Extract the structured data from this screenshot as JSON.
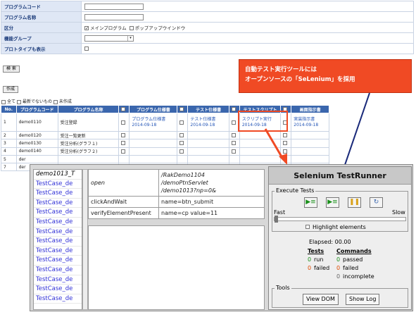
{
  "form": {
    "rows": [
      {
        "label": "プログラムコード",
        "type": "text"
      },
      {
        "label": "プログラム名称",
        "type": "text"
      },
      {
        "label": "区分",
        "type": "check",
        "options": [
          "メインプログラム",
          "ポップアップウインドウ"
        ]
      },
      {
        "label": "機能グループ",
        "type": "select"
      },
      {
        "label": "プロトタイプも表示",
        "type": "checkbox"
      }
    ],
    "search_button": "検 索",
    "create_button": "作成"
  },
  "filters": [
    "全て",
    "最新でないもの",
    "未作成"
  ],
  "grid": {
    "headers": [
      "No.",
      "プログラムコード",
      "プログラム名称",
      "",
      "プログラム仕様書",
      "",
      "テスト仕様書",
      "",
      "テストスクリプト",
      "",
      "画面指示書"
    ],
    "rows": [
      {
        "no": "1",
        "code": "demo0110",
        "name": "受注登録",
        "spec": [
          "プログラム仕様書",
          "2014-09-18"
        ],
        "test": [
          "テスト仕様書",
          "2014-09-18"
        ],
        "script": [
          "スクリプト実行",
          "2014-09-18"
        ],
        "screen": [
          "実装指示書",
          "2014-09-18"
        ]
      },
      {
        "no": "2",
        "code": "demo0120",
        "name": "受注一覧更新"
      },
      {
        "no": "3",
        "code": "demo0130",
        "name": "受注分析(グラフ１)"
      },
      {
        "no": "4",
        "code": "demo0140",
        "name": "受注分析(グラフ２)"
      },
      {
        "no": "5",
        "code": "der",
        "name": ""
      },
      {
        "no": "7",
        "code": "der",
        "name": ""
      }
    ]
  },
  "callout": {
    "line1": "自動テスト実行ツールには",
    "line2": "オープンソースの「SeLenium」を採用"
  },
  "selenium": {
    "cases": [
      "demo1013_T",
      "TestCase_de",
      "TestCase_de",
      "TestCase_de",
      "TestCase_de",
      "TestCase_de",
      "TestCase_de",
      "TestCase_de",
      "TestCase_de",
      "TestCase_de",
      "TestCase_de",
      "TestCase_de",
      "TestCase_de",
      "TestCase_de"
    ],
    "commands": [
      {
        "cmd": "open",
        "target": [
          "/RakDemo1104",
          "/demoPtnServlet",
          "/demo1013?np=0&"
        ]
      },
      {
        "cmd": "clickAndWait",
        "target": [
          "name=btn_submit"
        ]
      },
      {
        "cmd": "verifyElementPresent",
        "target": [
          "name=cp value=11"
        ]
      }
    ],
    "runner": {
      "title": "Selenium TestRunner",
      "execute_legend": "Execute Tests",
      "fast_label": "Fast",
      "slow_label": "Slow",
      "highlight_label": "Highlight elements",
      "elapsed_label": "Elapsed: 00.00",
      "tests_label": "Tests",
      "commands_label": "Commands",
      "tests_run": "0",
      "run_label": "run",
      "tests_failed": "0",
      "failed_label": "failed",
      "cmd_passed": "0",
      "passed_label": "passed",
      "cmd_failed": "0",
      "cmd_failed_label": "failed",
      "cmd_incomplete": "0",
      "incomplete_label": "incomplete",
      "tools_legend": "Tools",
      "view_dom": "View DOM",
      "show_log": "Show Log"
    }
  },
  "colors": {
    "callout": "#f04a24",
    "grid_header": "#3a66ad",
    "label_bg": "#dfe7f5",
    "arrow": "#f04a24",
    "callout_line": "#1a2a7a"
  }
}
